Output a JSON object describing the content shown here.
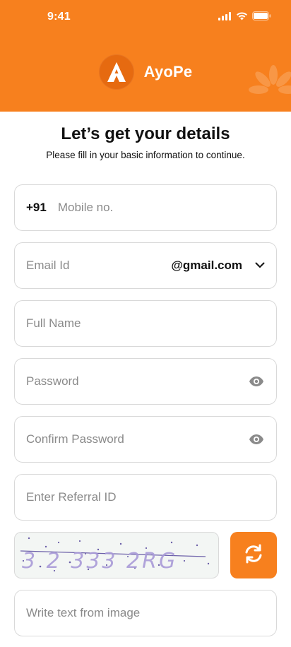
{
  "status_bar": {
    "time": "9:41"
  },
  "brand": {
    "name": "AyoPe"
  },
  "heading": {
    "title": "Let’s get your details",
    "subtitle": "Please fill in your basic information to continue."
  },
  "fields": {
    "mobile": {
      "prefix": "+91",
      "placeholder": "Mobile no."
    },
    "email": {
      "placeholder": "Email Id",
      "domain": "@gmail.com"
    },
    "full_name": {
      "placeholder": "Full Name"
    },
    "password": {
      "placeholder": "Password"
    },
    "confirm_password": {
      "placeholder": "Confirm Password"
    },
    "referral": {
      "placeholder": "Enter Referral ID"
    },
    "captcha_input": {
      "placeholder": "Write text from image"
    }
  },
  "captcha": {
    "text": "3 2 333 2RG"
  },
  "colors": {
    "brand_orange": "#F7801E",
    "placeholder_gray": "#8A8A8A",
    "border": "#D9D9D9"
  },
  "icons": [
    "signal-icon",
    "wifi-icon",
    "battery-icon",
    "chevron-down-icon",
    "eye-icon",
    "refresh-icon",
    "logo-icon"
  ]
}
